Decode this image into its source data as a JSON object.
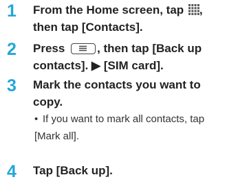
{
  "steps": [
    {
      "number": "1",
      "line1_pre": "From the Home screen, tap",
      "line1_post": ",",
      "line2": "then tap [Contacts].",
      "icon": "apps-grid-icon"
    },
    {
      "number": "2",
      "line1_pre": "Press",
      "line1_post": ", then tap [Back up",
      "line2": "contacts]. ▶ [SIM card].",
      "icon": "menu-key-icon"
    },
    {
      "number": "3",
      "line1": "Mark the contacts you want to",
      "line2": "copy.",
      "note_bullet": "•",
      "note_line1": "If you want to mark all contacts, tap",
      "note_line2": "[Mark all]."
    },
    {
      "number": "4",
      "line1": "Tap [Back up]."
    }
  ],
  "colors": {
    "step_number": "#23a6d8",
    "text": "#222222"
  }
}
